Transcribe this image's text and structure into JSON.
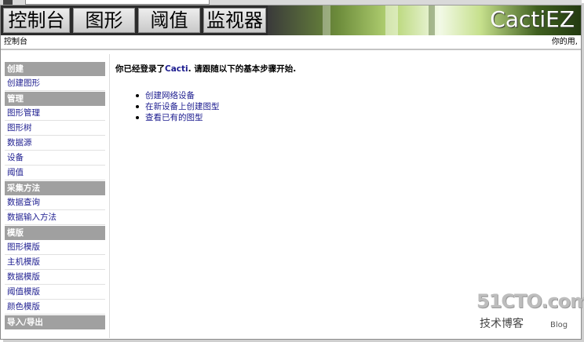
{
  "tabs": [
    {
      "label": "控制台"
    },
    {
      "label": "图形"
    },
    {
      "label": "阈值"
    },
    {
      "label": "监视器"
    }
  ],
  "brand": {
    "logo": "CactiEZ"
  },
  "breadcrumb": {
    "current": "控制台",
    "user_text": "你的用,"
  },
  "sidebar": {
    "sections": [
      {
        "header": "创建",
        "items": [
          "创建图形"
        ]
      },
      {
        "header": "管理",
        "items": [
          "图形管理",
          "图形树",
          "数据源",
          "设备",
          "阈值"
        ]
      },
      {
        "header": "采集方法",
        "items": [
          "数据查询",
          "数据输入方法"
        ]
      },
      {
        "header": "模版",
        "items": [
          "图形模版",
          "主机模版",
          "数据模版",
          "阈值模版",
          "颜色模版"
        ]
      },
      {
        "header": "导入/导出",
        "items": []
      }
    ]
  },
  "main": {
    "intro_prefix": "你已经登录了",
    "intro_app": "Cacti",
    "intro_suffix": ". 请跟随以下的基本步骤开始.",
    "steps": [
      "创建网络设备",
      "在新设备上创建图型",
      "查看已有的图型"
    ]
  },
  "watermark": {
    "logo": "51CTO.com",
    "sub": "技术博客",
    "blog": "Blog"
  },
  "colors": {
    "link": "#1c1c8f",
    "section_header": "#a0a0a0",
    "header_bg": "#2b2b2b"
  }
}
